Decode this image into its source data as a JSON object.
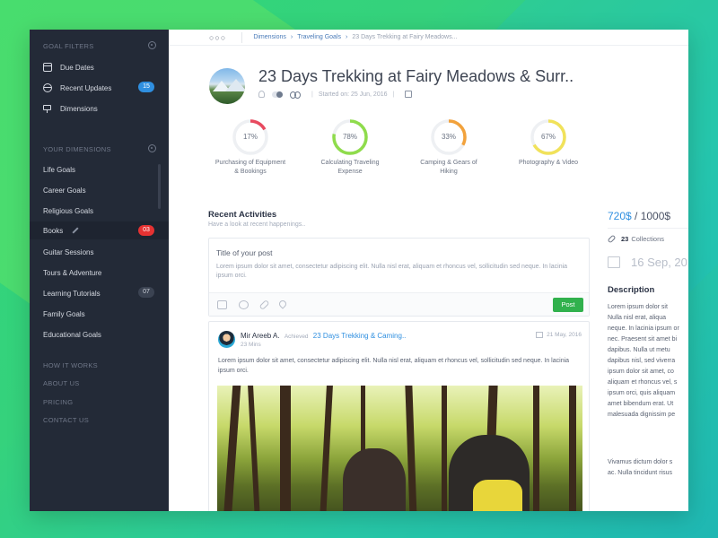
{
  "sidebar": {
    "goal_filters_heading": "GOAL FILTERS",
    "filters": [
      {
        "label": "Due Dates",
        "icon": "calendar-icon"
      },
      {
        "label": "Recent Updates",
        "icon": "globe-icon",
        "badge": "15"
      },
      {
        "label": "Dimensions",
        "icon": "signpost-icon"
      }
    ],
    "your_dimensions_heading": "YOUR DIMENSIONS",
    "dimensions": [
      {
        "label": "Life Goals"
      },
      {
        "label": "Career Goals"
      },
      {
        "label": "Religious Goals"
      },
      {
        "label": "Books",
        "badge": "03"
      },
      {
        "label": "Guitar Sessions"
      },
      {
        "label": "Tours & Adventure"
      },
      {
        "label": "Learning Tutorials",
        "badge": "07"
      },
      {
        "label": "Family Goals"
      },
      {
        "label": "Educational Goals"
      }
    ],
    "links": [
      "HOW IT WORKS",
      "ABOUT US",
      "PRICING",
      "CONTACT US"
    ]
  },
  "breadcrumb": {
    "items": [
      "Dimensions",
      "Traveling Goals"
    ],
    "current": "23 Days Trekking at Fairy Meadows..."
  },
  "goal": {
    "title": "23 Days Trekking at Fairy Meadows & Surr..",
    "started": "Started on: 25 Jun, 2016"
  },
  "progress": [
    {
      "percent": 17,
      "label_line1": "Purchasing of Equipment",
      "label_line2": "& Bookings",
      "color": "#e84a5f"
    },
    {
      "percent": 78,
      "label_line1": "Calculating Traveling",
      "label_line2": "Expense",
      "color": "#8fdc4c"
    },
    {
      "percent": 33,
      "label_line1": "Camping & Gears of",
      "label_line2": "Hiking",
      "color": "#f2a23c"
    },
    {
      "percent": 67,
      "label_line1": "Photography & Video",
      "label_line2": "",
      "color": "#f1e25a"
    }
  ],
  "recent": {
    "title": "Recent Activities",
    "subtitle": "Have a look at recent happenings..",
    "composer": {
      "title_placeholder": "Title of your post",
      "body_placeholder": "Lorem ipsum dolor sit amet, consectetur adipiscing elit. Nulla nisl erat, aliquam et rhoncus vel, sollicitudin sed neque. In lacinia ipsum orci.",
      "post_label": "Post"
    },
    "activity": {
      "user": "Mir Areeb A.",
      "verb": "Achieved",
      "goal": "23 Days Trekking & Caming..",
      "time": "23 Mins",
      "date": "21 May, 2016",
      "text": "Lorem ipsum dolor sit amet, consectetur adipiscing elit. Nulla nisl erat, aliquam et rhoncus vel, sollicitudin sed neque. In lacinia ipsum orci."
    }
  },
  "right": {
    "spent": "720$",
    "total": " / 1000$",
    "collections_count": "23",
    "collections_label": "Collections",
    "date": "16 Sep, 20",
    "description_title": "Description",
    "description_body": "Lorem ipsum dolor sit\nNulla nisl erat, aliqua\nneque. In lacinia ipsum or\nnec. Praesent sit amet bi\ndapibus. Nulla ut metu\ndapibus nisl, sed viverra\nipsum dolor sit amet, co\naliquam et rhoncus vel, s\nipsum orci, quis aliquam\namet bibendum erat. Ut\nmalesuada dignissim pe",
    "description_body2": "Vivamus dictum dolor s\nac. Nulla tincidunt risus"
  }
}
